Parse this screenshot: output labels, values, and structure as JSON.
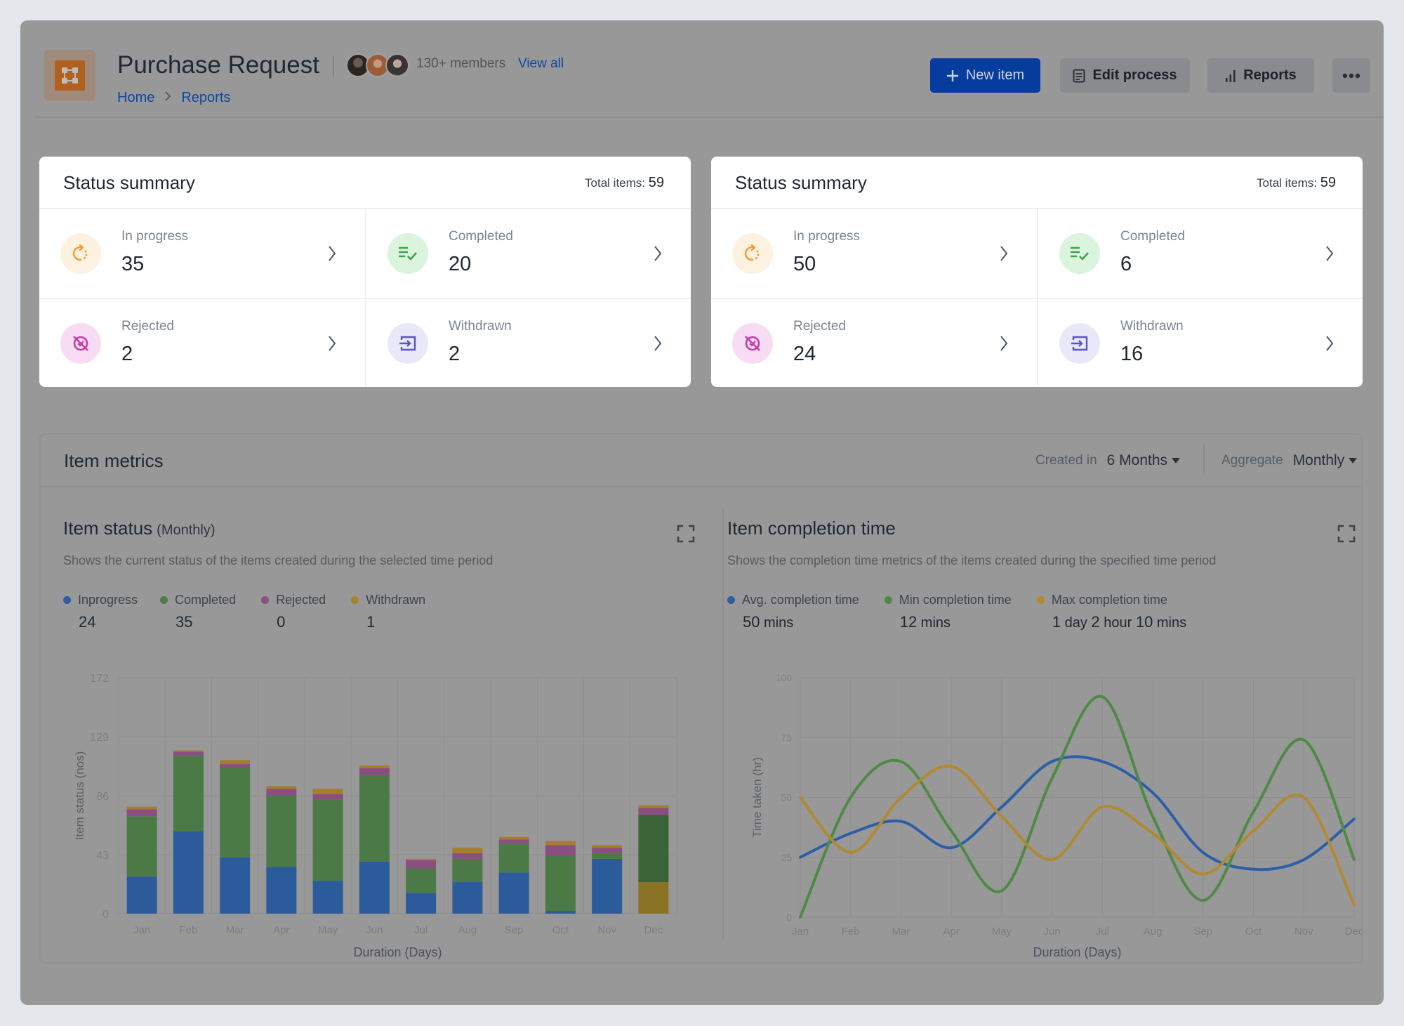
{
  "header": {
    "title": "Purchase Request",
    "members_text": "130+ members",
    "view_all": "View all",
    "breadcrumb": [
      "Home",
      "Reports"
    ],
    "buttons": {
      "new_item": "New item",
      "edit_process": "Edit process",
      "reports": "Reports",
      "more": "more-options"
    },
    "logo_icon": "process-flow-icon"
  },
  "status_cards": [
    {
      "title": "Status summary",
      "total_label": "Total items:",
      "total_value": "59",
      "items": [
        {
          "label": "In progress",
          "value": "35",
          "icon": "in-progress-icon"
        },
        {
          "label": "Completed",
          "value": "20",
          "icon": "completed-icon"
        },
        {
          "label": "Rejected",
          "value": "2",
          "icon": "rejected-icon"
        },
        {
          "label": "Withdrawn",
          "value": "2",
          "icon": "withdrawn-icon"
        }
      ]
    },
    {
      "title": "Status summary",
      "total_label": "Total items:",
      "total_value": "59",
      "items": [
        {
          "label": "In progress",
          "value": "50",
          "icon": "in-progress-icon"
        },
        {
          "label": "Completed",
          "value": "6",
          "icon": "completed-icon"
        },
        {
          "label": "Rejected",
          "value": "24",
          "icon": "rejected-icon"
        },
        {
          "label": "Withdrawn",
          "value": "16",
          "icon": "withdrawn-icon"
        }
      ]
    }
  ],
  "metrics": {
    "title": "Item metrics",
    "created_label": "Created in",
    "created_value": "6 Months",
    "aggregate_label": "Aggregate",
    "aggregate_value": "Monthly"
  },
  "item_status": {
    "title": "Item status",
    "subtitle": "(Monthly)",
    "description": "Shows the current status of the items created during the selected time period",
    "legend": [
      {
        "label": "Inprogress",
        "value": "24",
        "color": "#2f5ea3"
      },
      {
        "label": "Completed",
        "value": "35",
        "color": "#4d7c47"
      },
      {
        "label": "Rejected",
        "value": "0",
        "color": "#8a5085"
      },
      {
        "label": "Withdrawn",
        "value": "1",
        "color": "#a8822c"
      }
    ]
  },
  "completion_time": {
    "title": "Item completion time",
    "description": "Shows the completion time metrics of the items created during the specified time period",
    "legend": [
      {
        "label": "Avg. completion time",
        "parts": [
          [
            "50",
            " mins"
          ]
        ],
        "color": "#2f5ea3"
      },
      {
        "label": "Min completion time",
        "parts": [
          [
            "12",
            " mins"
          ]
        ],
        "color": "#4d8a47"
      },
      {
        "label": "Max completion time",
        "parts": [
          [
            "1",
            " day "
          ],
          [
            "2",
            " hour "
          ],
          [
            "10",
            " mins"
          ]
        ],
        "color": "#b5892f"
      }
    ]
  },
  "chart_data": [
    {
      "type": "bar",
      "stacked": true,
      "title": "Item status (Monthly)",
      "xlabel": "Duration (Days)",
      "ylabel": "Item status (nos)",
      "categories": [
        "Jan",
        "Feb",
        "Mar",
        "Apr",
        "May",
        "Jun",
        "Jul",
        "Aug",
        "Sep",
        "Oct",
        "Nov",
        "Dec"
      ],
      "ylim": [
        0,
        172
      ],
      "yticks": [
        0,
        43,
        86,
        129,
        172
      ],
      "grid": true,
      "series": [
        {
          "name": "Inprogress",
          "color": "#2c5b9c",
          "values": [
            27,
            60,
            41,
            34,
            24,
            38,
            15,
            23,
            30,
            2,
            40,
            23
          ]
        },
        {
          "name": "Completed",
          "color": "#4b7a47",
          "values": [
            44,
            55,
            66,
            52,
            59,
            63,
            18,
            17,
            21,
            40,
            4,
            49
          ]
        },
        {
          "name": "Rejected",
          "color": "#8a4f80",
          "values": [
            5,
            3,
            2,
            5,
            4,
            5,
            6,
            4,
            3,
            8,
            4,
            5
          ]
        },
        {
          "name": "Withdrawn",
          "color": "#a57d2e",
          "values": [
            2,
            1,
            3,
            2,
            4,
            2,
            1,
            4,
            2,
            3,
            2,
            2
          ]
        }
      ],
      "highlighted_category": "Dec",
      "highlight_colors": [
        "#8a7325",
        "#3b6338",
        "#8a4f80",
        "#a57d2e"
      ]
    },
    {
      "type": "line",
      "smooth": true,
      "title": "Item completion time",
      "xlabel": "Duration (Days)",
      "ylabel": "Time taken (hr)",
      "x": [
        "Jan",
        "Feb",
        "Mar",
        "Apr",
        "May",
        "Jun",
        "Jul",
        "Aug",
        "Sep",
        "Oct",
        "Nov",
        "Dec"
      ],
      "ylim": [
        0,
        100
      ],
      "yticks": [
        0,
        25,
        50,
        75,
        100
      ],
      "grid": true,
      "series": [
        {
          "name": "Avg. completion time",
          "color": "#2d5ea8",
          "values": [
            25,
            35,
            40,
            29,
            46,
            65,
            65,
            52,
            27,
            20,
            24,
            41
          ]
        },
        {
          "name": "Min completion time",
          "color": "#4e8a46",
          "values": [
            0,
            50,
            65,
            36,
            11,
            58,
            92,
            42,
            7,
            44,
            74,
            24
          ]
        },
        {
          "name": "Max completion time",
          "color": "#b08a30",
          "values": [
            50,
            27,
            50,
            63,
            42,
            24,
            46,
            35,
            18,
            36,
            50,
            5
          ]
        }
      ]
    }
  ]
}
